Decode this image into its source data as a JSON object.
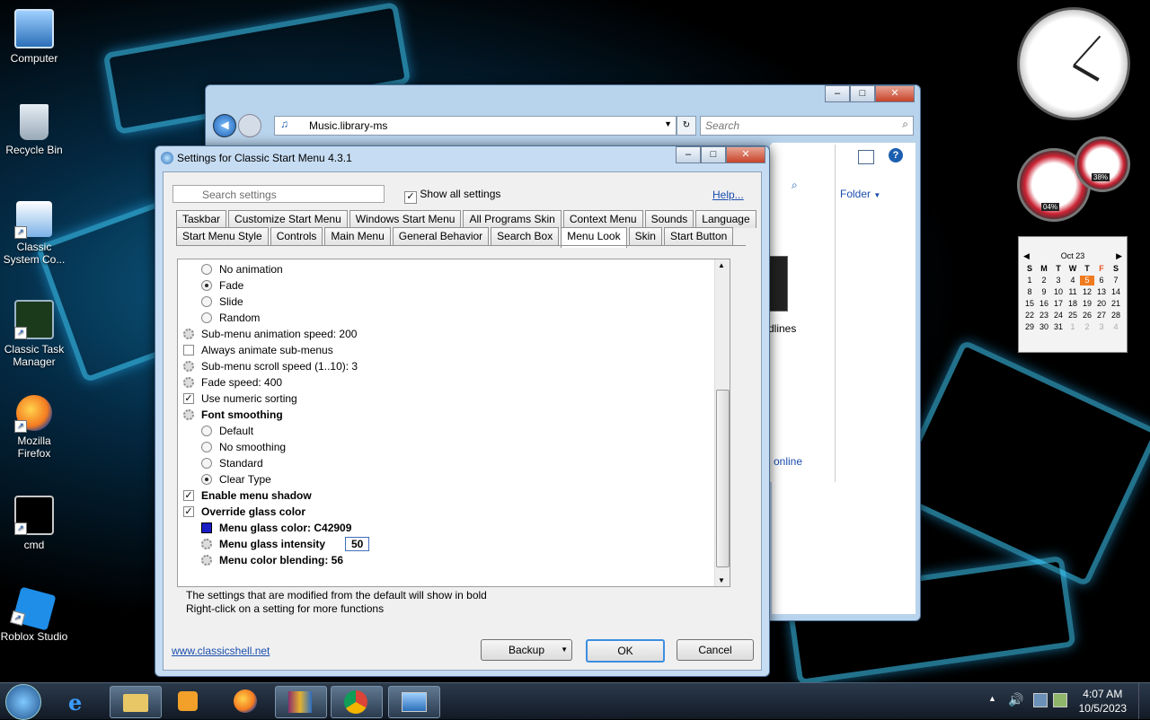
{
  "desktop": {
    "icons": [
      {
        "label": "Computer"
      },
      {
        "label": "Recycle Bin"
      },
      {
        "label": "Classic System Co..."
      },
      {
        "label": "Classic Task Manager"
      },
      {
        "label": "Mozilla Firefox"
      },
      {
        "label": "cmd"
      },
      {
        "label": "Roblox Studio"
      }
    ]
  },
  "explorer": {
    "address": "Music.library-ms",
    "search_placeholder": "Search",
    "folder_label": "Folder",
    "headlines_fragment": "dlines",
    "online_fragment": "online"
  },
  "dialog": {
    "title": "Settings for Classic Start Menu 4.3.1",
    "search_placeholder": "Search settings",
    "show_all_label": "Show all settings",
    "help_link": "Help...",
    "tabs_row1": [
      "Taskbar",
      "Customize Start Menu",
      "Windows Start Menu",
      "All Programs Skin",
      "Context Menu",
      "Sounds",
      "Language"
    ],
    "tabs_row2": [
      "Start Menu Style",
      "Controls",
      "Main Menu",
      "General Behavior",
      "Search Box",
      "Menu Look",
      "Skin",
      "Start Button"
    ],
    "active_tab": "Menu Look",
    "settings": [
      {
        "type": "radio",
        "checked": false,
        "indent": 1,
        "label": "No animation",
        "bold": false
      },
      {
        "type": "radio",
        "checked": true,
        "indent": 1,
        "label": "Fade",
        "bold": false
      },
      {
        "type": "radio",
        "checked": false,
        "indent": 1,
        "label": "Slide",
        "bold": false
      },
      {
        "type": "radio",
        "checked": false,
        "indent": 1,
        "label": "Random",
        "bold": false
      },
      {
        "type": "gear",
        "indent": 0,
        "label": "Sub-menu animation speed: 200",
        "bold": false
      },
      {
        "type": "check",
        "checked": false,
        "indent": 0,
        "label": "Always animate sub-menus",
        "bold": false
      },
      {
        "type": "gear",
        "indent": 0,
        "label": "Sub-menu scroll speed (1..10): 3",
        "bold": false
      },
      {
        "type": "gear",
        "indent": 0,
        "label": "Fade speed: 400",
        "bold": false
      },
      {
        "type": "check",
        "checked": true,
        "indent": 0,
        "label": "Use numeric sorting",
        "bold": false
      },
      {
        "type": "gear",
        "indent": 0,
        "label": "Font smoothing",
        "bold": true
      },
      {
        "type": "radio",
        "checked": false,
        "indent": 1,
        "label": "Default",
        "bold": false
      },
      {
        "type": "radio",
        "checked": false,
        "indent": 1,
        "label": "No smoothing",
        "bold": false
      },
      {
        "type": "radio",
        "checked": false,
        "indent": 1,
        "label": "Standard",
        "bold": false
      },
      {
        "type": "radio",
        "checked": true,
        "indent": 1,
        "label": "Clear Type",
        "bold": false
      },
      {
        "type": "check",
        "checked": true,
        "indent": 0,
        "label": "Enable menu shadow",
        "bold": true
      },
      {
        "type": "check",
        "checked": true,
        "indent": 0,
        "label": "Override glass color",
        "bold": true
      },
      {
        "type": "swatch",
        "indent": 1,
        "label": "Menu glass color: C42909",
        "bold": true
      },
      {
        "type": "gear",
        "indent": 1,
        "label": "Menu glass intensity",
        "bold": true,
        "editing_value": "50"
      },
      {
        "type": "gear",
        "indent": 1,
        "label": "Menu color blending: 56",
        "bold": true
      }
    ],
    "footer_note_1": "The settings that are modified from the default will show in bold",
    "footer_note_2": "Right-click on a setting for more functions",
    "website_link": "www.classicshell.net",
    "backup_label": "Backup",
    "ok_label": "OK",
    "cancel_label": "Cancel"
  },
  "gadgets": {
    "calendar_month": "Oct 23",
    "weekdays": [
      "S",
      "M",
      "T",
      "W",
      "T",
      "F",
      "S"
    ],
    "days": [
      "1",
      "2",
      "3",
      "4",
      "5",
      "6",
      "7",
      "8",
      "9",
      "10",
      "11",
      "12",
      "13",
      "14",
      "15",
      "16",
      "17",
      "18",
      "19",
      "20",
      "21",
      "22",
      "23",
      "24",
      "25",
      "26",
      "27",
      "28",
      "29",
      "30",
      "31",
      "1",
      "2",
      "3",
      "4"
    ],
    "today": "5",
    "cpu": "04%",
    "mem": "38%"
  },
  "taskbar": {
    "time": "4:07 AM",
    "date": "10/5/2023"
  }
}
